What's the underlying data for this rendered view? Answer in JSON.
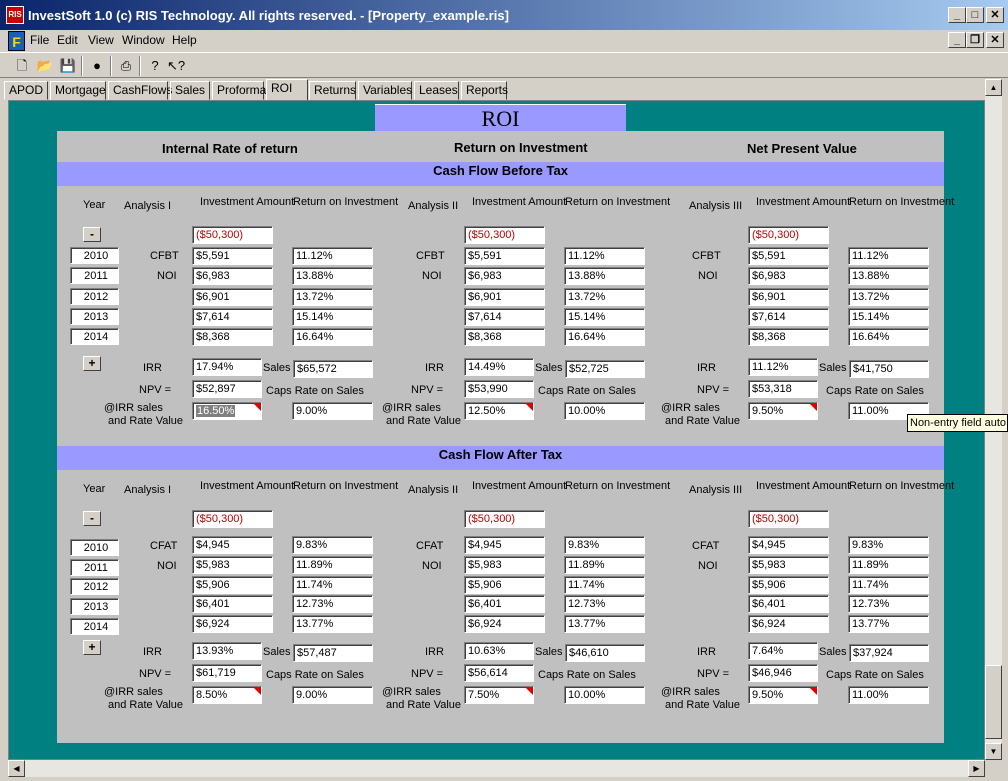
{
  "window": {
    "title": "InvestSoft 1.0 (c) RIS Technology. All rights reserved. - [Property_example.ris]",
    "app_icon": "RIS"
  },
  "menu": [
    "File",
    "Edit",
    "View",
    "Window",
    "Help"
  ],
  "tabs": [
    "APOD",
    "Mortgage",
    "CashFlows",
    "Sales",
    "Proforma",
    "ROI",
    "Returns",
    "Variables",
    "Leases",
    "Reports"
  ],
  "active_tab": "ROI",
  "page_title": "ROI",
  "columns": {
    "irr": "Internal Rate of return",
    "roi": "Return on Investment",
    "npv": "Net Present Value"
  },
  "labels": {
    "year": "Year",
    "investment_amount": "Investment Amount",
    "return_on_investment": "Return on Investment",
    "cfbt": "CFBT",
    "noi": "NOI",
    "cfat": "CFAT",
    "irr": "IRR",
    "npv": "NPV =",
    "sales": "Sales",
    "caps_rate": "Caps Rate on Sales",
    "irr_sales": "@IRR sales",
    "rate_value": "and Rate Value",
    "minus": "-",
    "plus": "+"
  },
  "years": [
    "2010",
    "2011",
    "2012",
    "2013",
    "2014"
  ],
  "tooltip": "Non-entry field auto",
  "sections": [
    {
      "title": "Cash Flow Before Tax",
      "row_label": "cfbt",
      "analyses": [
        {
          "name": "Analysis I",
          "initial": "($50,300)",
          "amounts": [
            "$5,591",
            "$6,983",
            "$6,901",
            "$7,614",
            "$8,368"
          ],
          "returns": [
            "11.12%",
            "13.88%",
            "13.72%",
            "15.14%",
            "16.64%"
          ],
          "irr": "17.94%",
          "sales": "$65,572",
          "npv": "$52,897",
          "irr_rate": "16.50%",
          "caps_rate": "9.00%"
        },
        {
          "name": "Analysis II",
          "initial": "($50,300)",
          "amounts": [
            "$5,591",
            "$6,983",
            "$6,901",
            "$7,614",
            "$8,368"
          ],
          "returns": [
            "11.12%",
            "13.88%",
            "13.72%",
            "15.14%",
            "16.64%"
          ],
          "irr": "14.49%",
          "sales": "$52,725",
          "npv": "$53,990",
          "irr_rate": "12.50%",
          "caps_rate": "10.00%"
        },
        {
          "name": "Analysis III",
          "initial": "($50,300)",
          "amounts": [
            "$5,591",
            "$6,983",
            "$6,901",
            "$7,614",
            "$8,368"
          ],
          "returns": [
            "11.12%",
            "13.88%",
            "13.72%",
            "15.14%",
            "16.64%"
          ],
          "irr": "11.12%",
          "sales": "$41,750",
          "npv": "$53,318",
          "irr_rate": "9.50%",
          "caps_rate": "11.00%"
        }
      ]
    },
    {
      "title": "Cash Flow After Tax",
      "row_label": "cfat",
      "analyses": [
        {
          "name": "Analysis I",
          "initial": "($50,300)",
          "amounts": [
            "$4,945",
            "$5,983",
            "$5,906",
            "$6,401",
            "$6,924"
          ],
          "returns": [
            "9.83%",
            "11.89%",
            "11.74%",
            "12.73%",
            "13.77%"
          ],
          "irr": "13.93%",
          "sales": "$57,487",
          "npv": "$61,719",
          "irr_rate": "8.50%",
          "caps_rate": "9.00%"
        },
        {
          "name": "Analysis II",
          "initial": "($50,300)",
          "amounts": [
            "$4,945",
            "$5,983",
            "$5,906",
            "$6,401",
            "$6,924"
          ],
          "returns": [
            "9.83%",
            "11.89%",
            "11.74%",
            "12.73%",
            "13.77%"
          ],
          "irr": "10.63%",
          "sales": "$46,610",
          "npv": "$56,614",
          "irr_rate": "7.50%",
          "caps_rate": "10.00%"
        },
        {
          "name": "Analysis III",
          "initial": "($50,300)",
          "amounts": [
            "$4,945",
            "$5,983",
            "$5,906",
            "$6,401",
            "$6,924"
          ],
          "returns": [
            "9.83%",
            "11.89%",
            "11.74%",
            "12.73%",
            "13.77%"
          ],
          "irr": "7.64%",
          "sales": "$37,924",
          "npv": "$46,946",
          "irr_rate": "9.50%",
          "caps_rate": "11.00%"
        }
      ]
    }
  ]
}
